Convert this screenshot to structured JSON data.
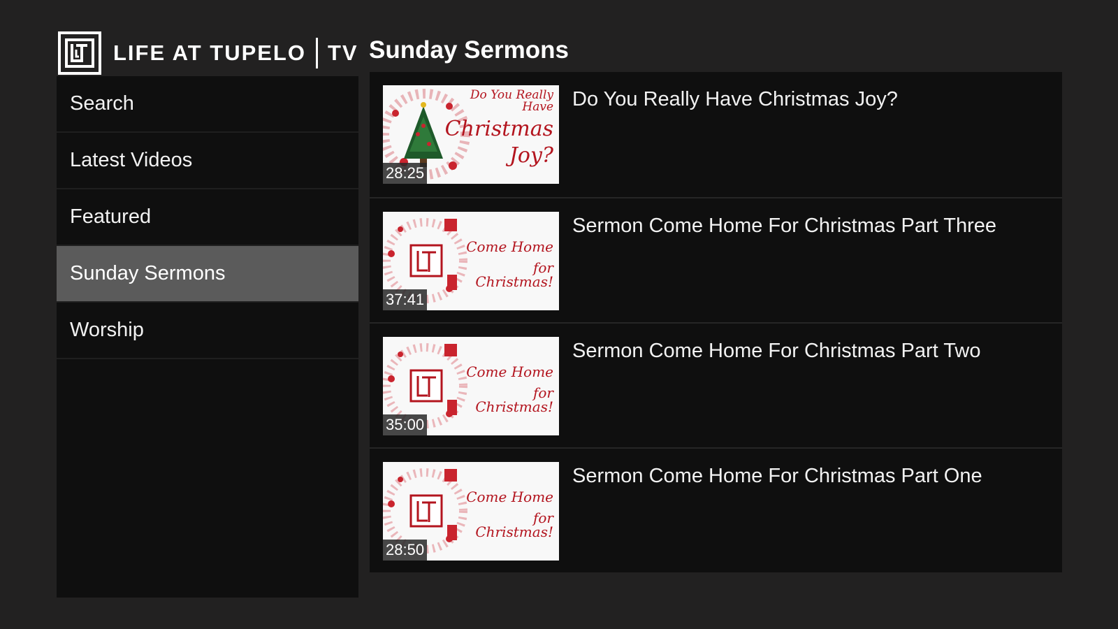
{
  "brand": {
    "name": "LIFE AT TUPELO",
    "suffix": "TV"
  },
  "page_title": "Sunday Sermons",
  "sidebar": {
    "items": [
      {
        "label": "Search",
        "active": false
      },
      {
        "label": "Latest Videos",
        "active": false
      },
      {
        "label": "Featured",
        "active": false
      },
      {
        "label": "Sunday Sermons",
        "active": true
      },
      {
        "label": "Worship",
        "active": false
      }
    ]
  },
  "videos": [
    {
      "title": "Do You Really Have Christmas Joy?",
      "duration": "28:25",
      "thumb_text": [
        "Do You Really Have",
        "Christmas",
        "Joy?"
      ]
    },
    {
      "title": "Sermon Come Home For Christmas Part Three",
      "duration": "37:41",
      "thumb_text": [
        "Come Home",
        "for Christmas!"
      ]
    },
    {
      "title": "Sermon Come Home For Christmas Part Two",
      "duration": "35:00",
      "thumb_text": [
        "Come Home",
        "for Christmas!"
      ]
    },
    {
      "title": "Sermon Come Home For Christmas Part One",
      "duration": "28:50",
      "thumb_text": [
        "Come Home",
        "for Christmas!"
      ]
    }
  ],
  "colors": {
    "background": "#222121",
    "panel": "#0f0f0f",
    "active_item": "#5b5b5b",
    "thumb_accent": "#b3141e"
  }
}
